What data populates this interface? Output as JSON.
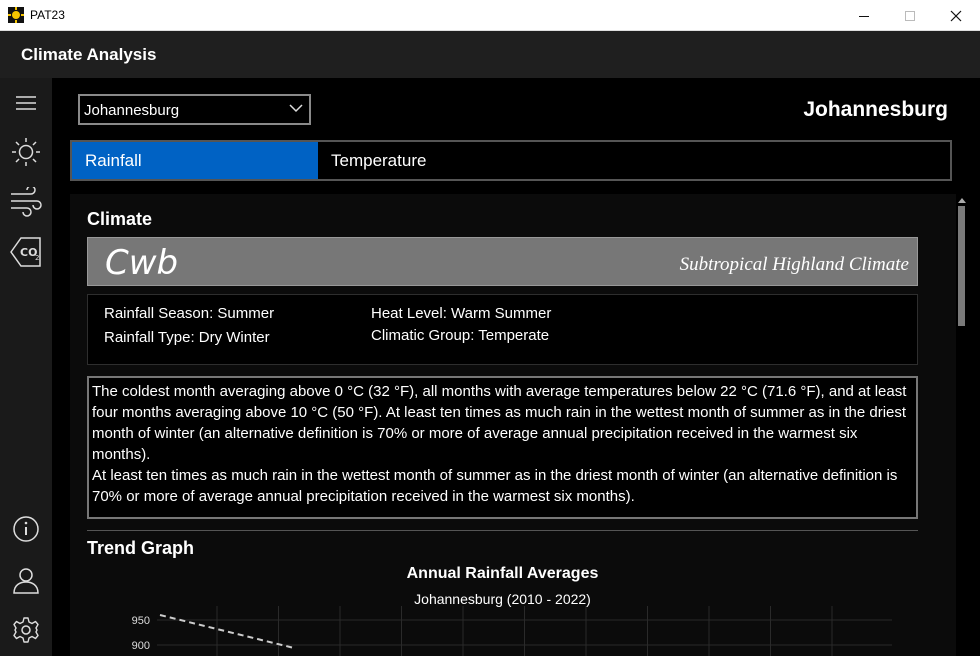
{
  "window": {
    "title": "PAT23",
    "minimize_glyph": "—",
    "maximize_glyph": "☐",
    "close_glyph": "✕"
  },
  "header": {
    "title": "Climate Analysis"
  },
  "nav": {
    "items": [
      {
        "icon": "hamburger-menu-icon"
      },
      {
        "icon": "sun-icon"
      },
      {
        "icon": "wind-icon"
      },
      {
        "icon": "co2-icon"
      },
      {
        "icon": "info-icon"
      },
      {
        "icon": "user-icon"
      },
      {
        "icon": "gear-icon"
      }
    ]
  },
  "location": {
    "selected": "Johannesburg",
    "heading": "Johannesburg"
  },
  "tabs": [
    {
      "label": "Rainfall",
      "active": true
    },
    {
      "label": "Temperature",
      "active": false
    }
  ],
  "climate": {
    "section_title": "Climate",
    "code": "Cwb",
    "name": "Subtropical Highland Climate",
    "banner_color": "#777777",
    "rainfall_season": "Rainfall Season: Summer",
    "rainfall_type": "Rainfall Type: Dry Winter",
    "heat_level": "Heat Level: Warm Summer",
    "climatic_group": "Climatic Group: Temperate",
    "description_1": "The coldest month averaging above 0 °C (32 °F), all months with average temperatures below 22 °C (71.6 °F), and at least four months averaging above 10 °C (50 °F). At least ten times as much rain in the wettest month of summer as in the driest month of winter (an alternative definition is 70% or more of average annual precipitation received in the warmest six months).",
    "description_2": "At least ten times as much rain in the wettest month of summer as in the driest month of winter (an alternative definition is 70% or more of average annual precipitation received in the warmest six months)."
  },
  "trend": {
    "section_title": "Trend Graph"
  },
  "chart_data": {
    "type": "line",
    "title": "Annual Rainfall Averages",
    "subtitle": "Johannesburg (2010 - 2022)",
    "y_ticks": [
      950,
      900
    ],
    "series": [
      {
        "values": [
          960,
          895
        ],
        "color": "#cccccc",
        "style": "dashed"
      }
    ]
  },
  "colors": {
    "accent": "#0062C4",
    "background": "#000000",
    "nav_background": "#1A1A1A",
    "header_background": "#1F1F1F"
  }
}
